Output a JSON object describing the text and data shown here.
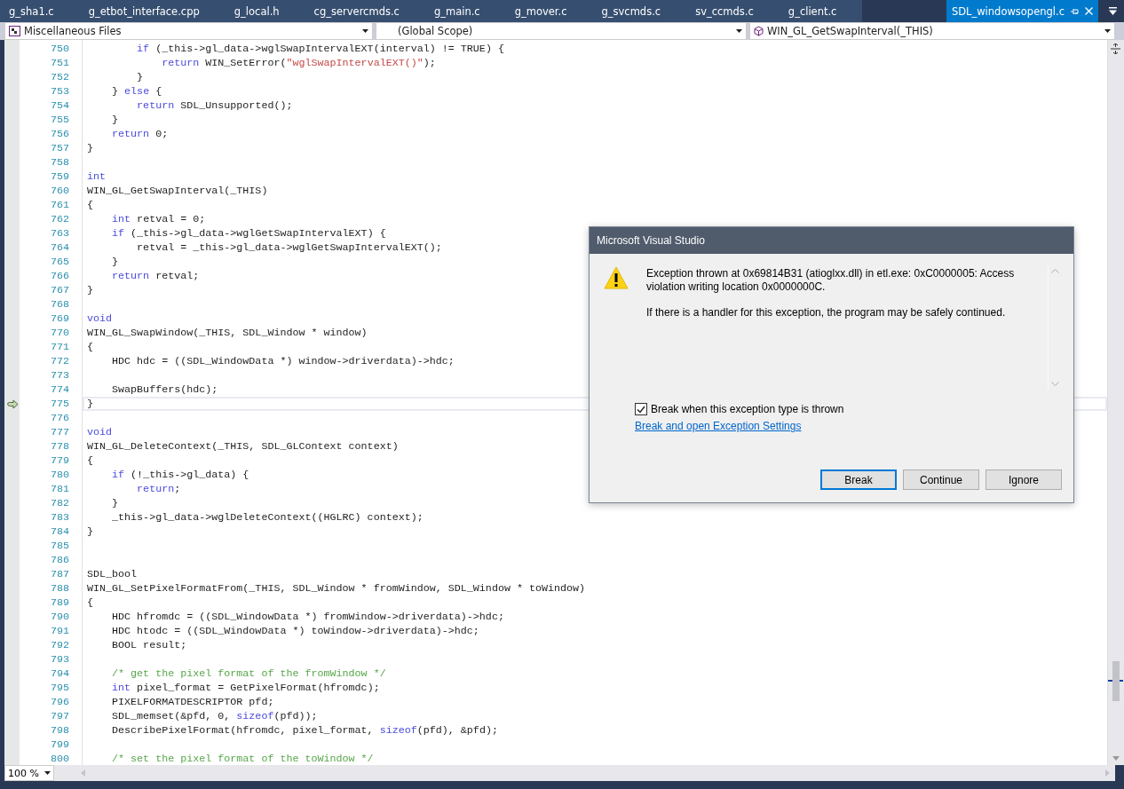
{
  "tabs": [
    {
      "label": "g_sha1.c",
      "selected": false
    },
    {
      "label": "g_etbot_interface.cpp",
      "selected": false
    },
    {
      "label": "g_local.h",
      "selected": false
    },
    {
      "label": "cg_servercmds.c",
      "selected": false
    },
    {
      "label": "g_main.c",
      "selected": false
    },
    {
      "label": "g_mover.c",
      "selected": false
    },
    {
      "label": "g_svcmds.c",
      "selected": false
    },
    {
      "label": "sv_ccmds.c",
      "selected": false
    },
    {
      "label": "g_client.c",
      "selected": false
    },
    {
      "label": "SDL_windowsopengl.c",
      "selected": true
    }
  ],
  "navigation": {
    "project": "Miscellaneous Files",
    "scope": "(Global Scope)",
    "member": "WIN_GL_GetSwapInterval(_THIS)"
  },
  "editor": {
    "lines": [
      {
        "number": "750",
        "current": false,
        "code": [
          {
            "kw": "        if"
          },
          {
            "text": " (_this->gl_data->wglSwapIntervalEXT(interval) != TRUE) {"
          }
        ]
      },
      {
        "number": "751",
        "current": false,
        "code": [
          {
            "kw": "            return"
          },
          {
            "text": " WIN_SetError("
          },
          {
            "str": "\"wglSwapIntervalEXT()\""
          },
          {
            "text": ");"
          }
        ]
      },
      {
        "number": "752",
        "current": false,
        "code": [
          {
            "text": "        }"
          }
        ]
      },
      {
        "number": "753",
        "current": false,
        "code": [
          {
            "text": "    } "
          },
          {
            "kw": "else"
          },
          {
            "text": " {"
          }
        ]
      },
      {
        "number": "754",
        "current": false,
        "code": [
          {
            "kw": "        return"
          },
          {
            "text": " SDL_Unsupported();"
          }
        ]
      },
      {
        "number": "755",
        "current": false,
        "code": [
          {
            "text": "    }"
          }
        ]
      },
      {
        "number": "756",
        "current": false,
        "code": [
          {
            "kw": "    return"
          },
          {
            "text": " 0;"
          }
        ]
      },
      {
        "number": "757",
        "current": false,
        "code": [
          {
            "text": "}"
          }
        ]
      },
      {
        "number": "758",
        "current": false
      },
      {
        "number": "759",
        "current": false,
        "code": [
          {
            "kw": "int"
          }
        ]
      },
      {
        "number": "760",
        "current": false,
        "code": [
          {
            "text": "WIN_GL_GetSwapInterval(_THIS)"
          }
        ]
      },
      {
        "number": "761",
        "current": false,
        "code": [
          {
            "text": "{"
          }
        ]
      },
      {
        "number": "762",
        "current": false,
        "code": [
          {
            "kw": "    int"
          },
          {
            "text": " retval = 0;"
          }
        ]
      },
      {
        "number": "763",
        "current": false,
        "code": [
          {
            "kw": "    if"
          },
          {
            "text": " (_this->gl_data->wglGetSwapIntervalEXT) {"
          }
        ]
      },
      {
        "number": "764",
        "current": false,
        "code": [
          {
            "text": "        retval = _this->gl_data->wglGetSwapIntervalEXT();"
          }
        ]
      },
      {
        "number": "765",
        "current": false,
        "code": [
          {
            "text": "    }"
          }
        ]
      },
      {
        "number": "766",
        "current": false,
        "code": [
          {
            "kw": "    return"
          },
          {
            "text": " retval;"
          }
        ]
      },
      {
        "number": "767",
        "current": false,
        "code": [
          {
            "text": "}"
          }
        ]
      },
      {
        "number": "768",
        "current": false
      },
      {
        "number": "769",
        "current": false,
        "code": [
          {
            "kw": "void"
          }
        ]
      },
      {
        "number": "770",
        "current": false,
        "code": [
          {
            "text": "WIN_GL_SwapWindow(_THIS, SDL_Window * window)"
          }
        ]
      },
      {
        "number": "771",
        "current": false,
        "code": [
          {
            "text": "{"
          }
        ]
      },
      {
        "number": "772",
        "current": false,
        "code": [
          {
            "text": "    HDC hdc = ((SDL_WindowData *) window->driverdata)->hdc;"
          }
        ]
      },
      {
        "number": "773",
        "current": false
      },
      {
        "number": "774",
        "current": false,
        "code": [
          {
            "text": "    SwapBuffers(hdc);"
          }
        ]
      },
      {
        "number": "775",
        "current": true,
        "code": [
          {
            "text": "}"
          }
        ]
      },
      {
        "number": "776",
        "current": false
      },
      {
        "number": "777",
        "current": false,
        "code": [
          {
            "kw": "void"
          }
        ]
      },
      {
        "number": "778",
        "current": false,
        "code": [
          {
            "text": "WIN_GL_DeleteContext(_THIS, SDL_GLContext context)"
          }
        ]
      },
      {
        "number": "779",
        "current": false,
        "code": [
          {
            "text": "{"
          }
        ]
      },
      {
        "number": "780",
        "current": false,
        "code": [
          {
            "kw": "    if"
          },
          {
            "text": " (!_this->gl_data) {"
          }
        ]
      },
      {
        "number": "781",
        "current": false,
        "code": [
          {
            "kw": "        return"
          },
          {
            "text": ";"
          }
        ]
      },
      {
        "number": "782",
        "current": false,
        "code": [
          {
            "text": "    }"
          }
        ]
      },
      {
        "number": "783",
        "current": false,
        "code": [
          {
            "text": "    _this->gl_data->wglDeleteContext((HGLRC) context);"
          }
        ]
      },
      {
        "number": "784",
        "current": false,
        "code": [
          {
            "text": "}"
          }
        ]
      },
      {
        "number": "785",
        "current": false
      },
      {
        "number": "786",
        "current": false
      },
      {
        "number": "787",
        "current": false,
        "code": [
          {
            "text": "SDL_bool"
          }
        ]
      },
      {
        "number": "788",
        "current": false,
        "code": [
          {
            "text": "WIN_GL_SetPixelFormatFrom(_THIS, SDL_Window * fromWindow, SDL_Window * toWindow)"
          }
        ]
      },
      {
        "number": "789",
        "current": false,
        "code": [
          {
            "text": "{"
          }
        ]
      },
      {
        "number": "790",
        "current": false,
        "code": [
          {
            "text": "    HDC hfromdc = ((SDL_WindowData *) fromWindow->driverdata)->hdc;"
          }
        ]
      },
      {
        "number": "791",
        "current": false,
        "code": [
          {
            "text": "    HDC htodc = ((SDL_WindowData *) toWindow->driverdata)->hdc;"
          }
        ]
      },
      {
        "number": "792",
        "current": false,
        "code": [
          {
            "text": "    BOOL result;"
          }
        ]
      },
      {
        "number": "793",
        "current": false
      },
      {
        "number": "794",
        "current": false,
        "code": [
          {
            "cmt": "    /* get the pixel format of the fromWindow */"
          }
        ]
      },
      {
        "number": "795",
        "current": false,
        "code": [
          {
            "kw": "    int"
          },
          {
            "text": " pixel_format = GetPixelFormat(hfromdc);"
          }
        ]
      },
      {
        "number": "796",
        "current": false,
        "code": [
          {
            "text": "    PIXELFORMATDESCRIPTOR pfd;"
          }
        ]
      },
      {
        "number": "797",
        "current": false,
        "code": [
          {
            "text": "    SDL_memset(&pfd, 0, "
          },
          {
            "kw": "sizeof"
          },
          {
            "text": "(pfd));"
          }
        ]
      },
      {
        "number": "798",
        "current": false,
        "code": [
          {
            "text": "    DescribePixelFormat(hfromdc, pixel_format, "
          },
          {
            "kw": "sizeof"
          },
          {
            "text": "(pfd), &pfd);"
          }
        ]
      },
      {
        "number": "799",
        "current": false
      },
      {
        "number": "800",
        "current": false,
        "code": [
          {
            "cmt": "    /* set the pixel format of the toWindow */"
          }
        ]
      }
    ]
  },
  "zoom": "100 %",
  "dialog": {
    "title": "Microsoft Visual Studio",
    "message": "Exception thrown at 0x69814B31 (atioglxx.dll) in etl.exe: 0xC0000005: Access violation writing location 0x0000000C.",
    "detail": "If there is a handler for this exception, the program may be safely continued.",
    "checkbox": {
      "label": "Break when this exception type is thrown",
      "checked": true
    },
    "link": "Break and open Exception Settings",
    "buttons": [
      {
        "label": "Break",
        "default": true
      },
      {
        "label": "Continue",
        "default": false
      },
      {
        "label": "Ignore",
        "default": false
      }
    ]
  }
}
